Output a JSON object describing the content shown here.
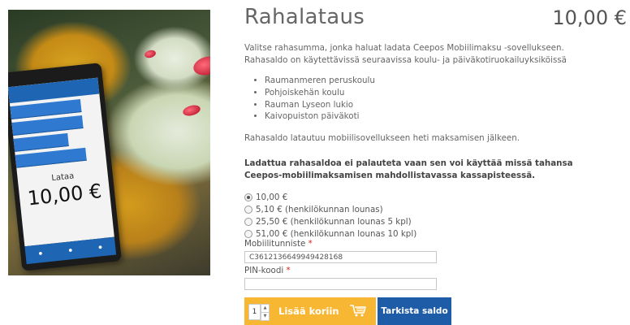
{
  "product": {
    "title": "Rahalataus",
    "price": "10,00 €",
    "description": "Valitse rahasumma, jonka haluat ladata Ceepos Mobiilimaksu -sovellukseen. Rahasaldo on käytettävissä seuraavissa koulu- ja päiväkotiruokailuyksiköissä",
    "schools": [
      "Raumanmeren peruskoulu",
      "Pohjoiskehän koulu",
      "Rauman Lyseon lukio",
      "Kaivopuiston päiväkoti"
    ],
    "note": "Rahasaldo latautuu mobiilisovellukseen heti maksamisen jälkeen.",
    "warning": "Ladattua rahasaldoa ei palauteta vaan sen voi käyttää missä tahansa Ceepos-mobiilimaksamisen mahdollistavassa kassapisteessä."
  },
  "image": {
    "phone_label": "Lataa",
    "phone_amount": "10,00 €"
  },
  "options": [
    {
      "label": "10,00 €",
      "checked": true
    },
    {
      "label": "5,10 € (henkilökunnan lounas)",
      "checked": false
    },
    {
      "label": "25,50 € (henkilökunnan lounas 5 kpl)",
      "checked": false
    },
    {
      "label": "51,00 € (henkilökunnan lounas 10 kpl)",
      "checked": false
    }
  ],
  "form": {
    "mobile_id_label": "Mobiilitunniste",
    "mobile_id_value": "C3612136649949428168",
    "pin_label": "PIN-koodi",
    "required_mark": "*",
    "pin_value": ""
  },
  "cart": {
    "quantity": "1",
    "add_label": "Lisää koriin",
    "check_label": "Tarkista saldo"
  },
  "colors": {
    "accent_yellow": "#f7b733",
    "accent_blue": "#1f5ca8",
    "required_red": "#d9241b"
  }
}
